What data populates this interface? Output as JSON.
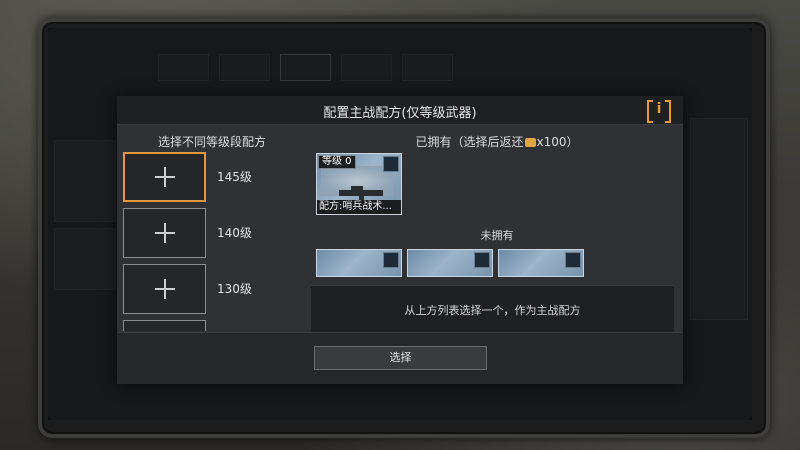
{
  "dialog": {
    "title": "配置主战配方(仅等级武器)",
    "info_icon": "info-icon",
    "info_label": "i"
  },
  "left_panel": {
    "title": "选择不同等级段配方",
    "tiers": [
      {
        "label": "145级",
        "selected": true
      },
      {
        "label": "140级",
        "selected": false
      },
      {
        "label": "130级",
        "selected": false
      }
    ]
  },
  "right_panel": {
    "owned_title_prefix": "已拥有（选择后返还",
    "owned_title_suffix": "x100）",
    "coin_icon": "coin-icon",
    "owned_cards": [
      {
        "level": "等级 0",
        "name": "配方:哨兵战术..."
      }
    ],
    "unowned_title": "未拥有",
    "unowned_cards_count": 3
  },
  "tooltip": {
    "text": "从上方列表选择一个，作为主战配方"
  },
  "footer": {
    "select_label": "选择"
  },
  "colors": {
    "accent": "#e8963a",
    "dialog_bg": "#2f3134",
    "header_bg": "#1f2022"
  }
}
